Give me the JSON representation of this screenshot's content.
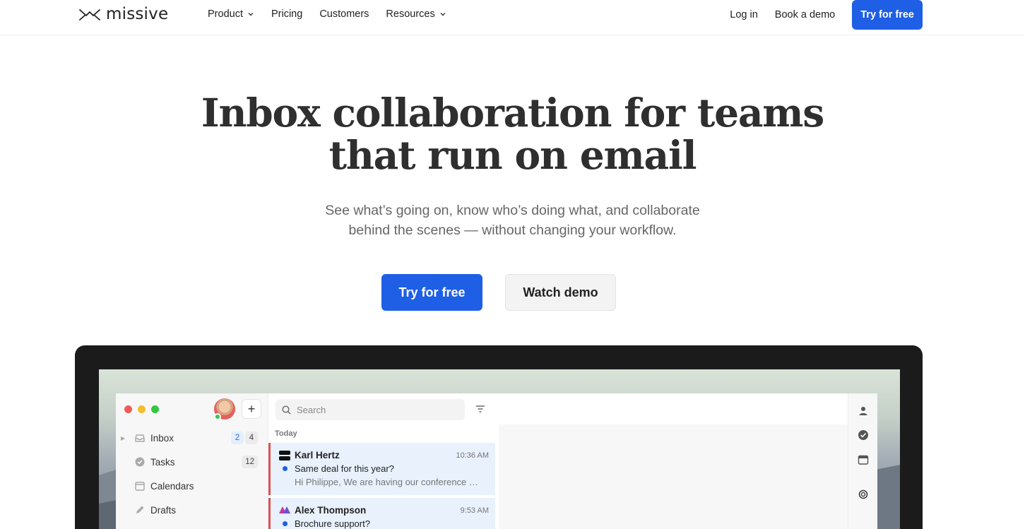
{
  "nav": {
    "brand": "missive",
    "links": [
      {
        "label": "Product",
        "has_dropdown": true
      },
      {
        "label": "Pricing",
        "has_dropdown": false
      },
      {
        "label": "Customers",
        "has_dropdown": false
      },
      {
        "label": "Resources",
        "has_dropdown": true
      }
    ],
    "login": "Log in",
    "book_demo": "Book a demo",
    "try_free": "Try for free"
  },
  "hero": {
    "title_line1": "Inbox collaboration for teams",
    "title_line2": "that run on email",
    "subtitle_line1": "See what’s going on, know who’s doing what, and collaborate",
    "subtitle_line2": "behind the scenes — without changing your workflow.",
    "cta_primary": "Try for free",
    "cta_secondary": "Watch demo"
  },
  "app": {
    "sidebar": {
      "items": [
        {
          "label": "Inbox",
          "icon": "inbox-icon",
          "badges": [
            "2",
            "4"
          ]
        },
        {
          "label": "Tasks",
          "icon": "check-circle-icon",
          "badges": [
            "12"
          ]
        },
        {
          "label": "Calendars",
          "icon": "calendar-icon",
          "badges": []
        },
        {
          "label": "Drafts",
          "icon": "pencil-icon",
          "badges": []
        }
      ],
      "add_label": "+"
    },
    "search_placeholder": "Search",
    "group_label": "Today",
    "conversations": [
      {
        "sender": "Karl Hertz",
        "time": "10:36 AM",
        "subject": "Same deal for this year?",
        "preview": "Hi Philippe, We are having our conference …"
      },
      {
        "sender": "Alex Thompson",
        "time": "9:53 AM",
        "subject": "Brochure support?",
        "preview": ""
      }
    ]
  },
  "colors": {
    "accent": "#1f5fe6",
    "traffic_red": "#ee5c54",
    "traffic_yellow": "#f5bd2f",
    "traffic_green": "#2fc840",
    "selected_row": "#e8f1fc"
  }
}
